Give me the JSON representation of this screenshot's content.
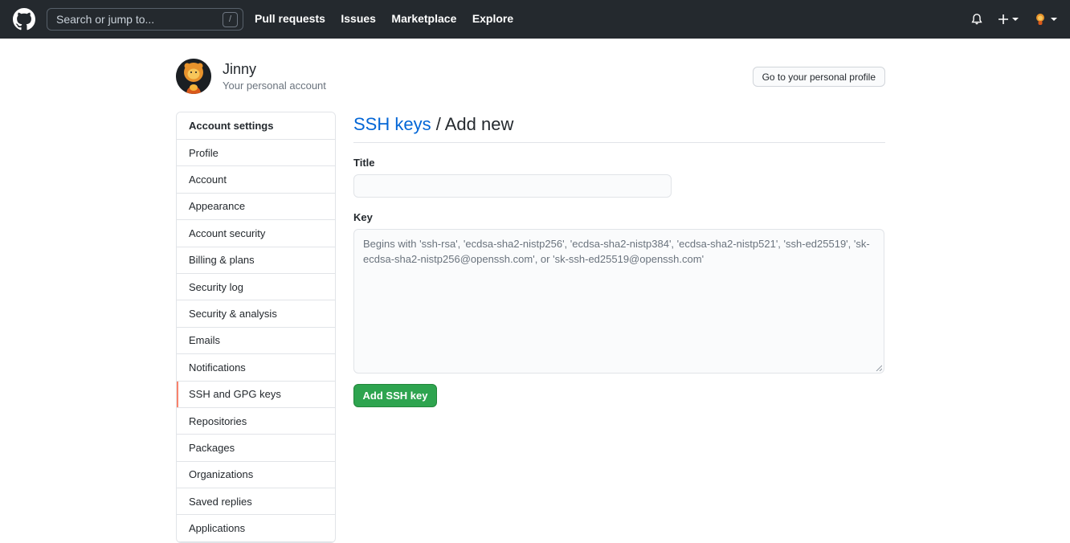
{
  "header": {
    "search_placeholder": "Search or jump to...",
    "search_shortcut": "/",
    "nav": [
      "Pull requests",
      "Issues",
      "Marketplace",
      "Explore"
    ]
  },
  "profile": {
    "name": "Jinny",
    "subtitle": "Your personal account",
    "profile_button": "Go to your personal profile"
  },
  "sidebar": {
    "heading": "Account settings",
    "items": [
      {
        "label": "Profile"
      },
      {
        "label": "Account"
      },
      {
        "label": "Appearance"
      },
      {
        "label": "Account security"
      },
      {
        "label": "Billing & plans"
      },
      {
        "label": "Security log"
      },
      {
        "label": "Security & analysis"
      },
      {
        "label": "Emails"
      },
      {
        "label": "Notifications"
      },
      {
        "label": "SSH and GPG keys",
        "active": true
      },
      {
        "label": "Repositories"
      },
      {
        "label": "Packages"
      },
      {
        "label": "Organizations"
      },
      {
        "label": "Saved replies"
      },
      {
        "label": "Applications"
      }
    ]
  },
  "main": {
    "title_link": "SSH keys",
    "title_rest": "/ Add new",
    "title_label": "Title",
    "title_value": "",
    "key_label": "Key",
    "key_placeholder": "Begins with 'ssh-rsa', 'ecdsa-sha2-nistp256', 'ecdsa-sha2-nistp384', 'ecdsa-sha2-nistp521', 'ssh-ed25519', 'sk-ecdsa-sha2-nistp256@openssh.com', or 'sk-ssh-ed25519@openssh.com'",
    "submit_label": "Add SSH key"
  },
  "colors": {
    "header_bg": "#24292e",
    "link": "#0366d6",
    "accent_active": "#f9826c",
    "primary_button": "#2ea44f"
  }
}
